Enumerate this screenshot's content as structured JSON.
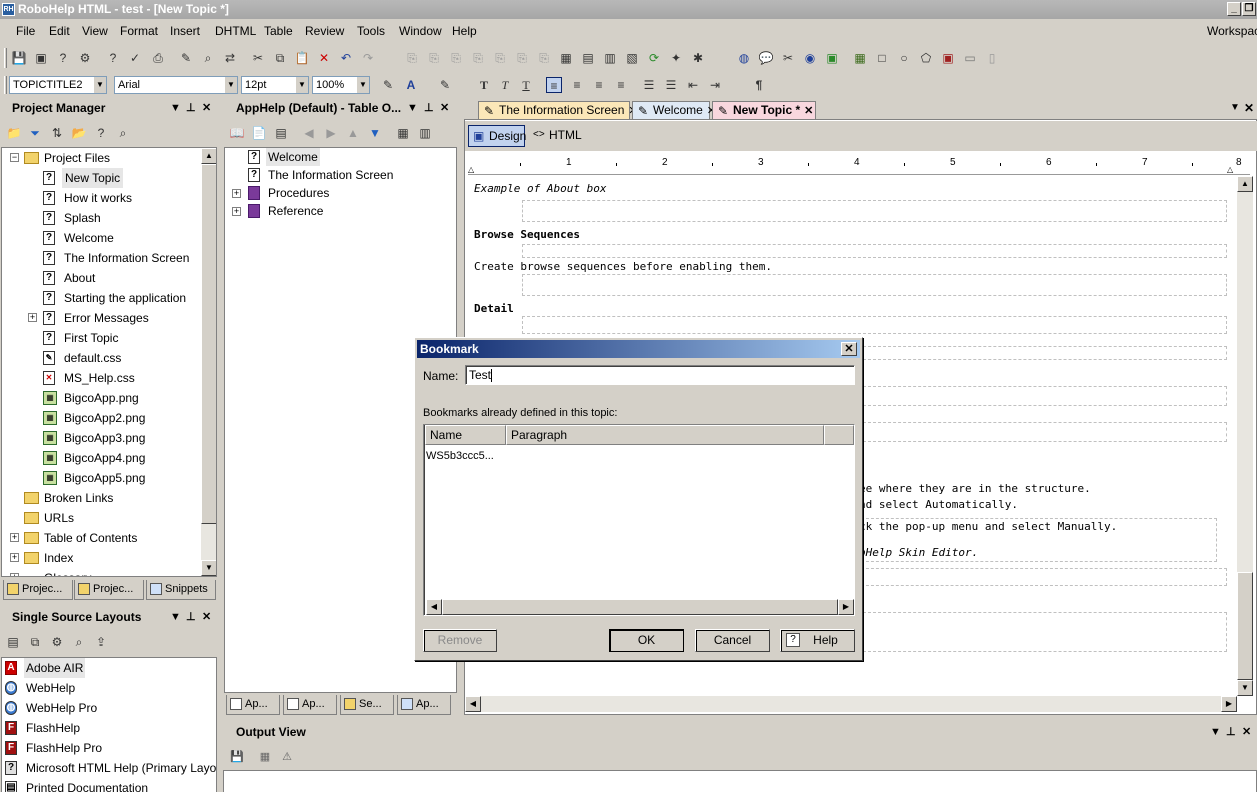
{
  "app": {
    "title": "RoboHelp HTML - test - [New Topic *]",
    "workspace": "Workspace"
  },
  "menu": [
    "File",
    "Edit",
    "View",
    "Format",
    "Insert",
    "DHTML",
    "Table",
    "Review",
    "Tools",
    "Window",
    "Help"
  ],
  "format_bar": {
    "style": "TOPICTITLE2",
    "font": "Arial",
    "size": "12pt",
    "zoom": "100%"
  },
  "project_manager": {
    "title": "Project Manager",
    "root": "Project Files",
    "items": [
      {
        "label": "New Topic",
        "icon": "topic-icon"
      },
      {
        "label": "How it works",
        "icon": "topic-icon"
      },
      {
        "label": "Splash",
        "icon": "topic-icon"
      },
      {
        "label": "Welcome",
        "icon": "topic-icon"
      },
      {
        "label": "The Information Screen",
        "icon": "topic-icon"
      },
      {
        "label": "About",
        "icon": "topic-icon"
      },
      {
        "label": "Starting the application",
        "icon": "topic-icon"
      },
      {
        "label": "Error Messages",
        "icon": "topic-icon"
      },
      {
        "label": "First Topic",
        "icon": "topic-icon"
      },
      {
        "label": "default.css",
        "icon": "css-icon"
      },
      {
        "label": "MS_Help.css",
        "icon": "css-icon"
      },
      {
        "label": "BigcoApp.png",
        "icon": "image-icon"
      },
      {
        "label": "BigcoApp2.png",
        "icon": "image-icon"
      },
      {
        "label": "BigcoApp3.png",
        "icon": "image-icon"
      },
      {
        "label": "BigcoApp4.png",
        "icon": "image-icon"
      },
      {
        "label": "BigcoApp5.png",
        "icon": "image-icon"
      }
    ],
    "folders": [
      "Broken Links",
      "URLs",
      "Table of Contents",
      "Index",
      "Glossary"
    ],
    "tabs": [
      "Projec...",
      "Projec...",
      "Snippets"
    ]
  },
  "ssl": {
    "title": "Single Source Layouts",
    "items": [
      "Adobe AIR",
      "WebHelp",
      "WebHelp Pro",
      "FlashHelp",
      "FlashHelp Pro",
      "Microsoft HTML Help (Primary Layout)",
      "Printed Documentation"
    ]
  },
  "toc": {
    "title": "AppHelp (Default) - Table O...",
    "items": [
      "Welcome",
      "The Information Screen",
      "Procedures",
      "Reference"
    ],
    "tabs": [
      "Ap...",
      "Ap...",
      "Se...",
      "Ap..."
    ]
  },
  "editor": {
    "tabs": [
      "The Information Screen",
      "Welcome",
      "New Topic *"
    ],
    "view_tabs": {
      "design": "Design",
      "html": "HTML"
    },
    "ruler_numbers": [
      "1",
      "2",
      "3",
      "4",
      "5",
      "6",
      "7",
      "8"
    ],
    "content": {
      "caption": "Example of About box",
      "heading1": "Browse Sequences",
      "para1": "Create browse sequences before enabling them.",
      "heading2": "Detail",
      "frag1": "ee where they are in the structure.",
      "frag2": "nd select Automatically.",
      "frag3": "ck the pop-up menu and select Manually.",
      "frag4": "bHelp Skin Editor."
    }
  },
  "output": {
    "title": "Output View"
  },
  "dialog": {
    "title": "Bookmark",
    "name_label": "Name:",
    "name_value": "Test",
    "list_label": "Bookmarks already defined in this topic:",
    "columns": [
      "Name",
      "Paragraph"
    ],
    "rows": [
      {
        "name": "WS5b3ccc5...",
        "paragraph": ""
      }
    ],
    "buttons": {
      "remove": "Remove",
      "ok": "OK",
      "cancel": "Cancel",
      "help": "Help"
    }
  }
}
